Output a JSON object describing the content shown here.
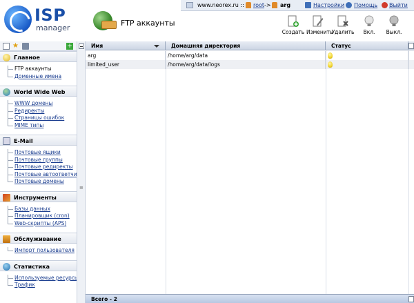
{
  "topbar": {
    "host": "www.neorex.ru ::",
    "user_root": "root",
    "arrow": "->",
    "user_current": "arg",
    "settings": "Настройки",
    "help": "Помощь",
    "logout": "Выйти"
  },
  "logo": {
    "isp": "ISP",
    "manager": "manager"
  },
  "page": {
    "title": "FTP аккаунты"
  },
  "toolbar": [
    {
      "label": "Создать",
      "icon": "create-icon"
    },
    {
      "label": "Изменить",
      "icon": "edit-icon"
    },
    {
      "label": "Удалить",
      "icon": "delete-icon"
    },
    {
      "label": "Вкл.",
      "icon": "enable-bulb-icon"
    },
    {
      "label": "Выкл.",
      "icon": "disable-bulb-icon"
    }
  ],
  "sidebar": {
    "sections": [
      {
        "title": "Главное",
        "icon": "home-icon",
        "items": [
          "FTP аккаунты",
          "Доменные имена"
        ]
      },
      {
        "title": "World Wide Web",
        "icon": "globe-icon",
        "items": [
          "WWW домены",
          "Редиректы",
          "Страницы ошибок",
          "MIME типы"
        ]
      },
      {
        "title": "E-Mail",
        "icon": "mail-icon",
        "items": [
          "Почтовые ящики",
          "Почтовые группы",
          "Почтовые редиректы",
          "Почтовые автоответчики",
          "Почтовые домены"
        ]
      },
      {
        "title": "Инструменты",
        "icon": "tools-icon",
        "items": [
          "Базы данных",
          "Планировщик (cron)",
          "Web-скрипты (APS)"
        ]
      },
      {
        "title": "Обслуживание",
        "icon": "service-icon",
        "items": [
          "Импорт пользователя"
        ]
      },
      {
        "title": "Статистика",
        "icon": "stats-icon",
        "items": [
          "Используемые ресурсы",
          "Трафик"
        ]
      }
    ]
  },
  "table": {
    "columns": [
      "Имя",
      "Домашняя директория",
      "Статус"
    ],
    "rows": [
      {
        "name": "arg",
        "home": "/home/arg/data",
        "status": "on"
      },
      {
        "name": "limited_user",
        "home": "/home/arg/data/logs",
        "status": "on"
      }
    ],
    "footer": "Всего - 2"
  },
  "colors": {
    "link": "#1a3d8f",
    "header_bg": "#cdd6e4",
    "footer_bg": "#b8c8e2",
    "bulb": "#f0d22a"
  }
}
